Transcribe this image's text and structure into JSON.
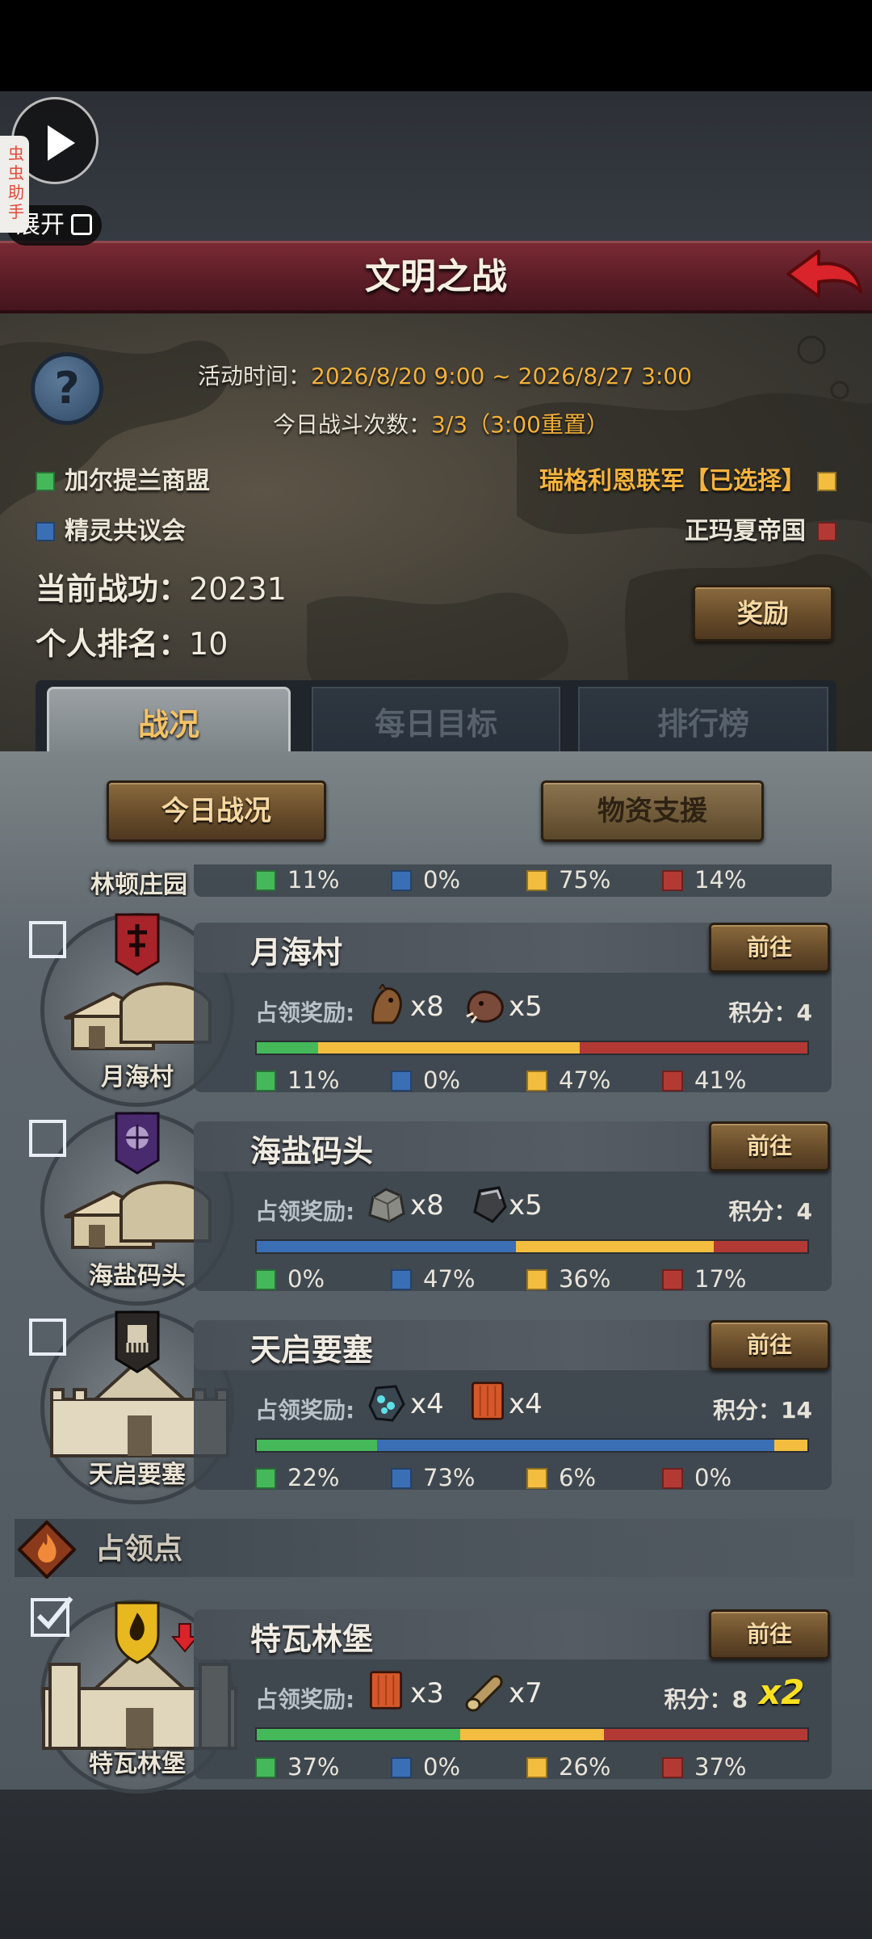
{
  "floating_widget": {
    "tag_text": "虫虫助手",
    "expand_label": "展开"
  },
  "header": {
    "title": "文明之战"
  },
  "event": {
    "time_label": "活动时间：",
    "time_value": "2026/8/20 9:00 ~ 2026/8/27 3:00",
    "battles_label": "今日战斗次数：",
    "battles_value": "3/3（3:00重置）"
  },
  "factions": [
    {
      "name": "加尔提兰商盟",
      "color": "#45b95a"
    },
    {
      "name": "精灵共议会",
      "color": "#3b6fb5"
    },
    {
      "name": "瑞格利恩联军【已选择】",
      "color": "#f3be3f"
    },
    {
      "name": "正玛夏帝国",
      "color": "#b33a34"
    }
  ],
  "stats": {
    "merit_label": "当前战功：",
    "merit_value": "20231",
    "rank_label": "个人排名：",
    "rank_value": "10"
  },
  "buttons": {
    "reward": "奖励",
    "today_status": "今日战况",
    "supply": "物资支援",
    "go": "前往"
  },
  "tabs": [
    "战况",
    "每日目标",
    "排行榜"
  ],
  "partial_row": {
    "city": "林顿庄园",
    "pct": [
      "11%",
      "0%",
      "75%",
      "14%"
    ]
  },
  "rows": [
    {
      "city": "月海村",
      "reward_label": "占领奖励:",
      "rewards": [
        {
          "icon": "horse-icon",
          "qty": "x8"
        },
        {
          "icon": "boar-icon",
          "qty": "x5"
        }
      ],
      "score_text": "积分：4",
      "bar": [
        11,
        0,
        47,
        41
      ],
      "pct": [
        "11%",
        "0%",
        "47%",
        "41%"
      ],
      "checked": false,
      "flag": "red-banner"
    },
    {
      "city": "海盐码头",
      "reward_label": "占领奖励:",
      "rewards": [
        {
          "icon": "stone-icon",
          "qty": "x8"
        },
        {
          "icon": "iron-ore-icon",
          "qty": "x5"
        }
      ],
      "score_text": "积分：4",
      "bar": [
        0,
        47,
        36,
        17
      ],
      "pct": [
        "0%",
        "47%",
        "36%",
        "17%"
      ],
      "checked": false,
      "flag": "purple-banner"
    },
    {
      "city": "天启要塞",
      "reward_label": "占领奖励:",
      "rewards": [
        {
          "icon": "gem-ore-icon",
          "qty": "x4"
        },
        {
          "icon": "plank-icon",
          "qty": "x4"
        }
      ],
      "score_text": "积分：14",
      "bar": [
        22,
        73,
        6,
        0
      ],
      "pct": [
        "22%",
        "73%",
        "6%",
        "0%"
      ],
      "checked": false,
      "flag": "black-banner"
    }
  ],
  "section": {
    "title": "占领点"
  },
  "occupied_row": {
    "city": "特瓦林堡",
    "reward_label": "占领奖励:",
    "rewards": [
      {
        "icon": "plank-icon",
        "qty": "x3"
      },
      {
        "icon": "log-icon",
        "qty": "x7"
      }
    ],
    "score_text": "积分：8",
    "multiplier": "x2",
    "bar": [
      37,
      0,
      26,
      37
    ],
    "pct": [
      "37%",
      "0%",
      "26%",
      "37%"
    ],
    "checked": true,
    "flag": "yellow-shield"
  }
}
